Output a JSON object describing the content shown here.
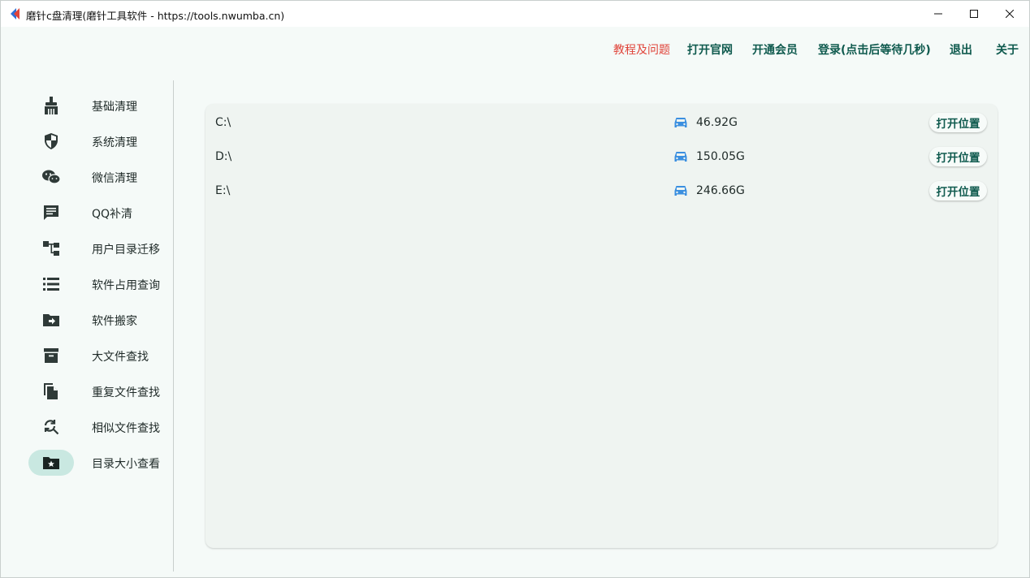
{
  "window": {
    "title": "磨针c盘清理(磨针工具软件 - https://tools.nwumba.cn)"
  },
  "topmenu": {
    "help": "教程及问题",
    "website": "打开官网",
    "member": "开通会员",
    "login": "登录(点击后等待几秒)",
    "logout": "退出",
    "about": "关于"
  },
  "colors": {
    "accent": "#0f5a4e",
    "help_red": "#e0443a",
    "active_bg": "#c9e8e1",
    "drive_icon": "#3b8fe0"
  },
  "sidebar": {
    "items": [
      {
        "label": "基础清理",
        "icon": "broom-icon"
      },
      {
        "label": "系统清理",
        "icon": "shield-icon"
      },
      {
        "label": "微信清理",
        "icon": "wechat-icon"
      },
      {
        "label": "QQ补清",
        "icon": "chat-icon"
      },
      {
        "label": "用户目录迁移",
        "icon": "tree-icon"
      },
      {
        "label": "软件占用查询",
        "icon": "list-icon"
      },
      {
        "label": "软件搬家",
        "icon": "folder-move-icon"
      },
      {
        "label": "大文件查找",
        "icon": "archive-icon"
      },
      {
        "label": "重复文件查找",
        "icon": "copy-icon"
      },
      {
        "label": "相似文件查找",
        "icon": "search-refresh-icon"
      },
      {
        "label": "目录大小查看",
        "icon": "folder-star-icon",
        "active": true
      }
    ]
  },
  "drives": [
    {
      "name": "C:\\",
      "size": "46.92G",
      "button": "打开位置"
    },
    {
      "name": "D:\\",
      "size": "150.05G",
      "button": "打开位置"
    },
    {
      "name": "E:\\",
      "size": "246.66G",
      "button": "打开位置"
    }
  ]
}
